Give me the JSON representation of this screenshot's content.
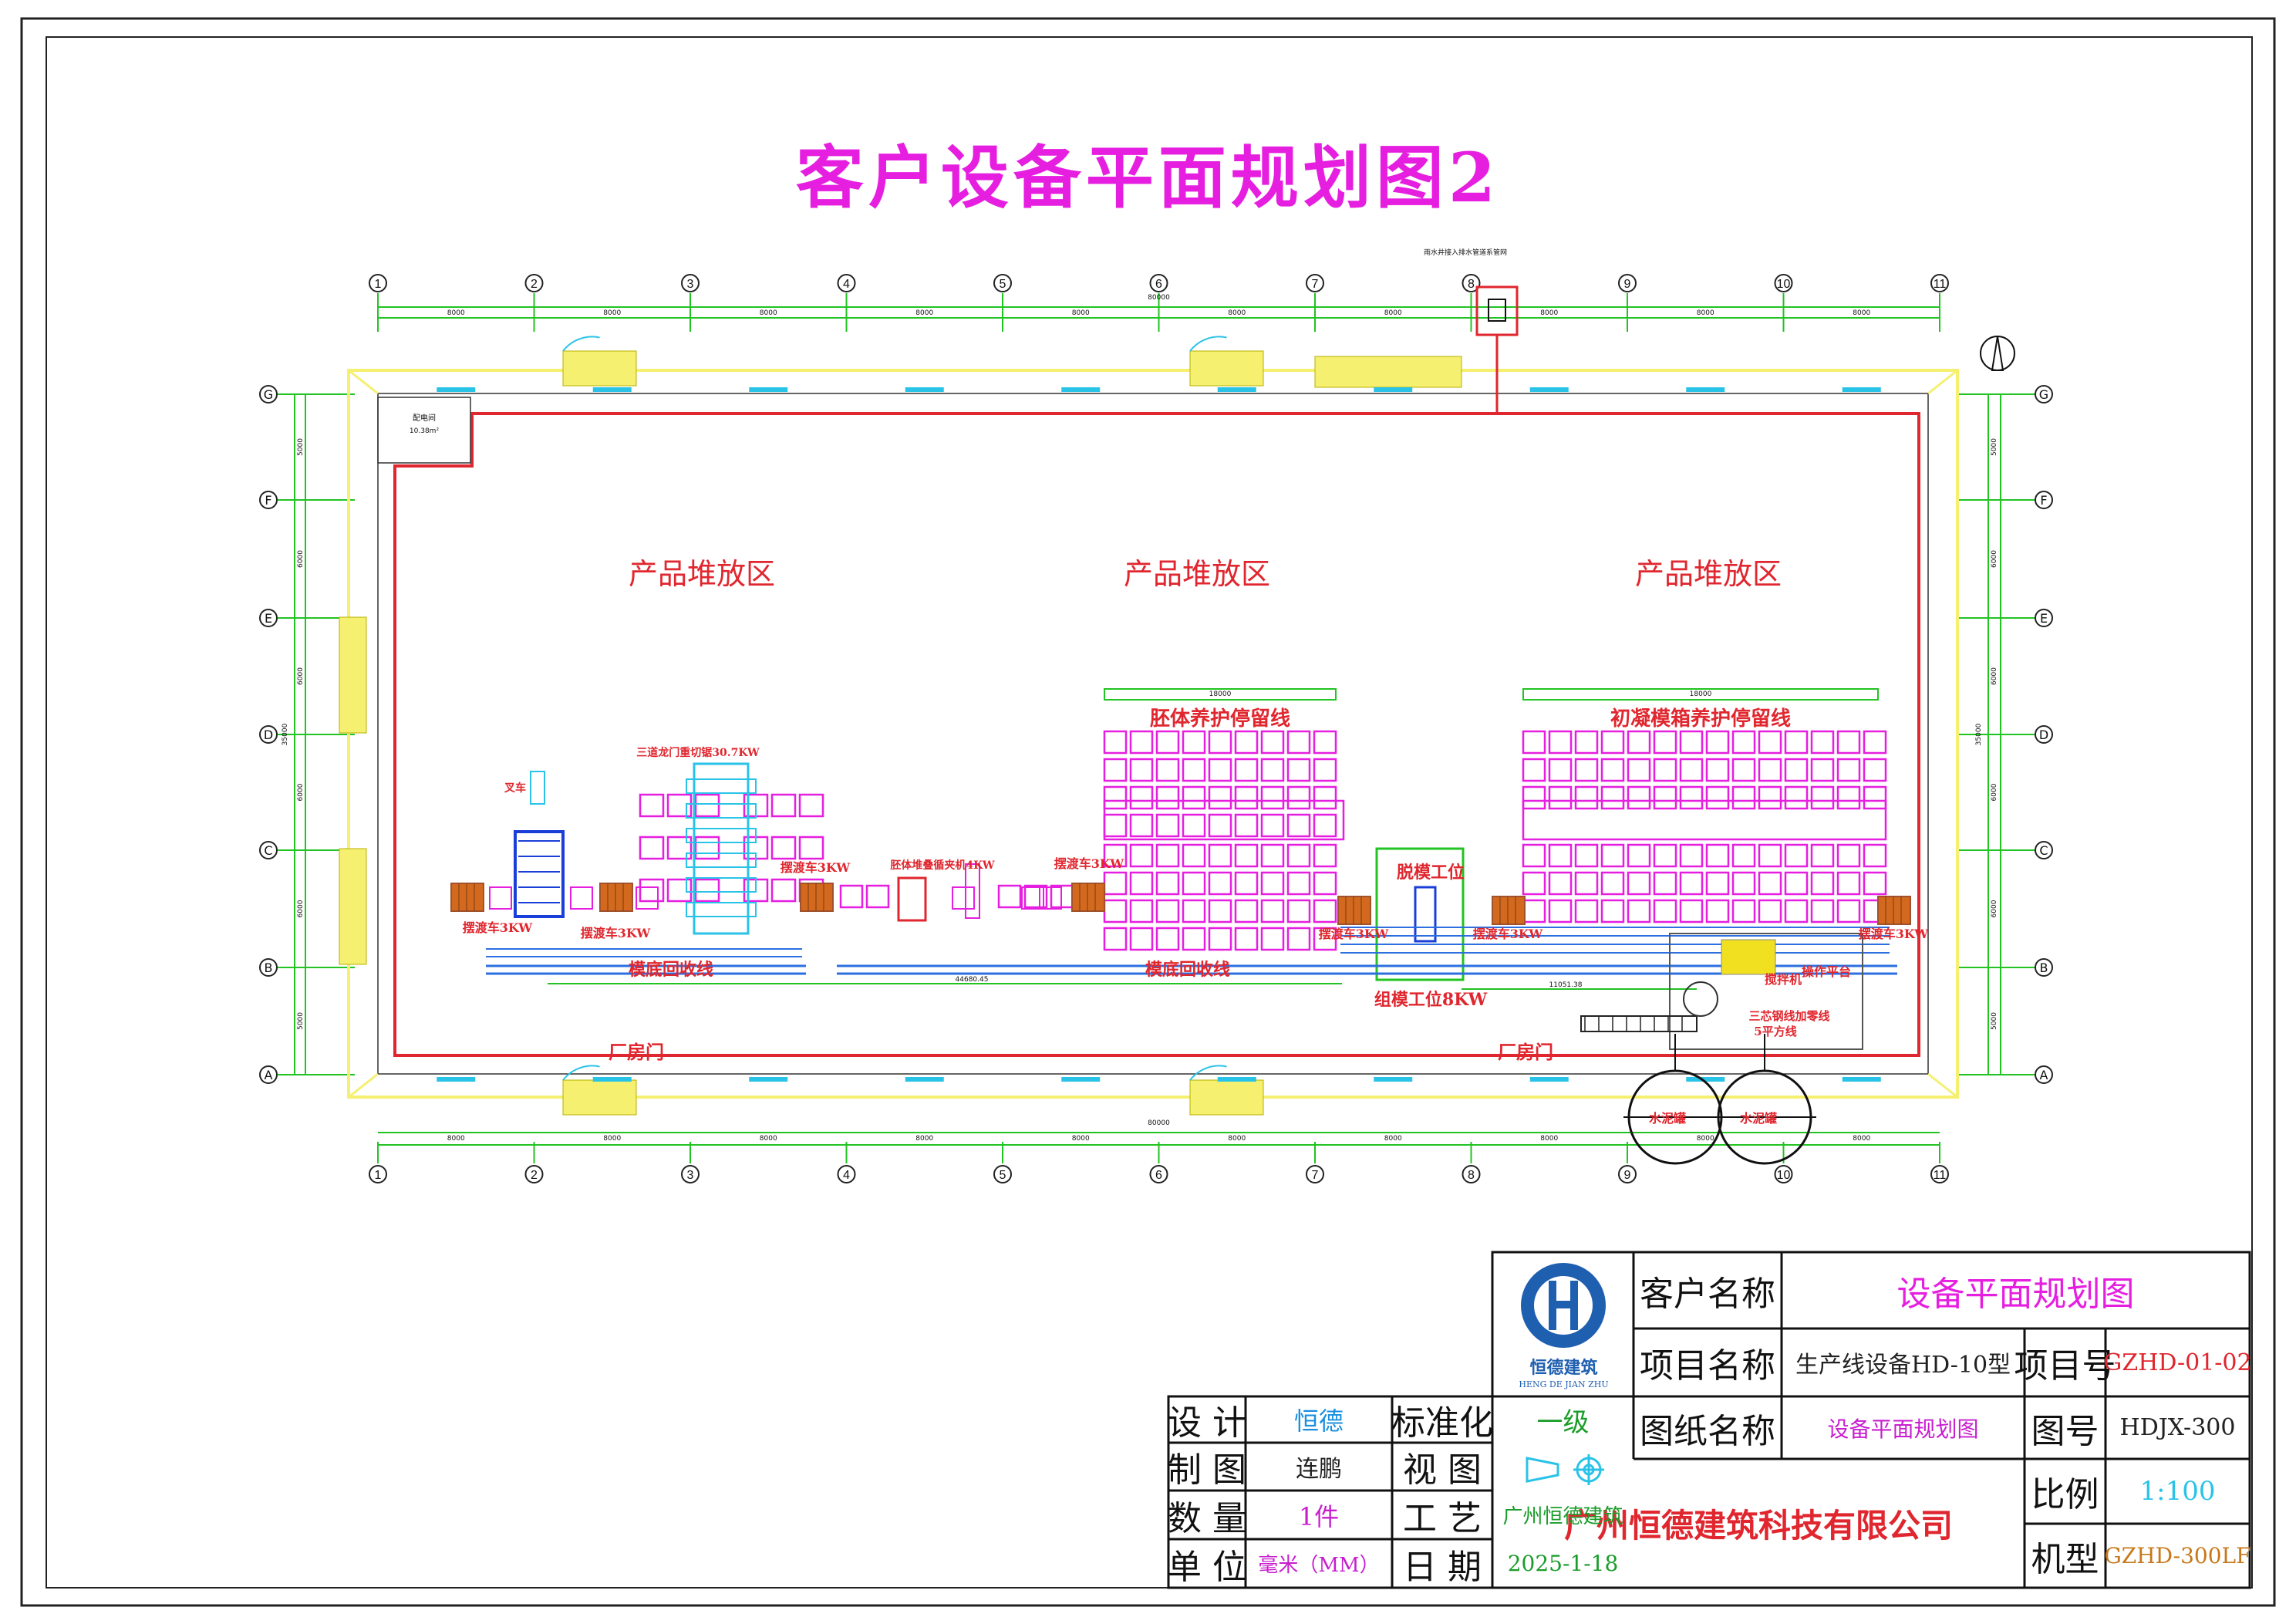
{
  "page_title": "客户设备平面规划图2",
  "colors": {
    "wall": "#e0262e",
    "grid": "#22c322",
    "yellow": "#f5f070",
    "magenta": "#e61ee0",
    "blue": "#2d6fe0",
    "cyan": "#2ac3e8",
    "brown": "#a0522d"
  },
  "grid": {
    "columns": [
      "1",
      "2",
      "3",
      "4",
      "5",
      "6",
      "7",
      "8",
      "9",
      "10",
      "11"
    ],
    "rows": [
      "G",
      "F",
      "E",
      "D",
      "C",
      "B",
      "A"
    ],
    "span": "8000",
    "overall_x": "80000",
    "overall_y": "35000",
    "row_spans": [
      "5000",
      "6000",
      "6000",
      "6000",
      "6000",
      "5000"
    ]
  },
  "zones": {
    "storage": "产品堆放区",
    "curing_line": "胚体养护停留线",
    "mold_curing_line": "初凝模箱养护停留线",
    "mold_base_return": "模底回收线",
    "demold": "脱模工位",
    "assembly": "组模工位8KW",
    "gantry": "三道龙门重切锯30.7KW",
    "stacker": "胚体堆叠循夹机4KW",
    "ferry": "摆渡车3KW",
    "forklift": "叉车",
    "factory_door": "厂房门",
    "operation_platform": "操作平台",
    "mixer": "搅拌机",
    "wire_line": "三芯钢线加零线",
    "square_line": "5平方线",
    "cement_tank": "水泥罐",
    "power_room": "配电间",
    "power_area": "10.38m²",
    "top_note": "雨水井接入排水管道系管网",
    "lower_dim": "44680.45",
    "right_dim": "11051.38",
    "curing_dim": "18000"
  },
  "title_block": {
    "company_logo_text": "恒德建筑",
    "company_logo_pinyin": "HENG DE JIAN ZHU",
    "client_name_label": "客户名称",
    "client_name_value": "设备平面规划图",
    "project_name_label": "项目名称",
    "project_name_value": "生产线设备HD-10型",
    "project_no_label": "项目号",
    "project_no_value": "GZHD-01-02",
    "drawing_name_label": "图纸名称",
    "drawing_name_value": "设备平面规划图",
    "drawing_no_label": "图号",
    "drawing_no_value": "HDJX-300",
    "scale_label": "比例",
    "scale_value": "1:100",
    "model_label": "机型",
    "model_value": "GZHD-300LF",
    "company_full": "广州恒德建筑科技有限公司",
    "design_label": "设 计",
    "design_value": "恒德",
    "draw_label": "制 图",
    "draw_value": "连鹏",
    "qty_label": "数 量",
    "qty_value": "1件",
    "unit_label": "单 位",
    "unit_value": "毫米（MM）",
    "std_label": "标准化",
    "std_value": "一级",
    "view_label": "视 图",
    "craft_label": "工 艺",
    "craft_value": "广州恒德建筑",
    "date_label": "日 期",
    "date_value": "2025-1-18"
  }
}
